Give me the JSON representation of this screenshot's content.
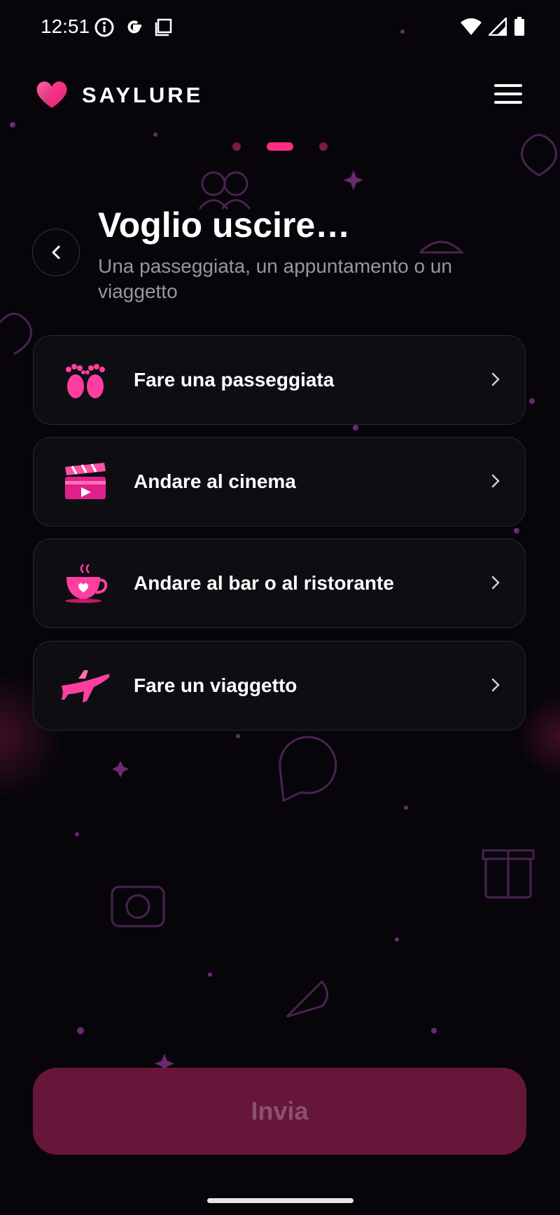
{
  "status_bar": {
    "time": "12:51"
  },
  "header": {
    "brand": "SAYLURE"
  },
  "pager": {
    "count": 3,
    "active": 1
  },
  "page": {
    "title": "Voglio uscire…",
    "subtitle": "Una passeggiata, un appuntamento o un viaggetto"
  },
  "options": [
    {
      "label": "Fare una passeggiata",
      "icon": "footprints-icon"
    },
    {
      "label": "Andare al cinema",
      "icon": "clapperboard-icon"
    },
    {
      "label": "Andare al bar o al ristorante",
      "icon": "coffee-cup-icon"
    },
    {
      "label": "Fare un viaggetto",
      "icon": "airplane-icon"
    }
  ],
  "submit": {
    "label": "Invia",
    "enabled": false
  },
  "colors": {
    "accent": "#ff2e80",
    "background": "#07050a",
    "button_disabled": "#661638"
  }
}
